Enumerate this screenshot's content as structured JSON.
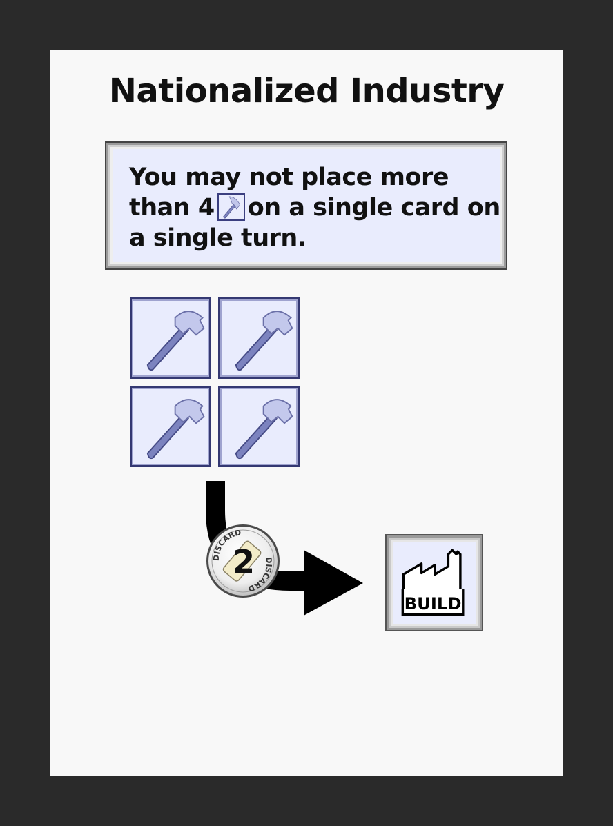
{
  "card": {
    "title": "Nationalized Industry",
    "rule_part1": "You may not place more than 4",
    "rule_part2": "on a single card on a single turn.",
    "hammer_count": 4,
    "discard_word": "DISCARD",
    "discard_number": "2",
    "build_label": "BUILD"
  },
  "icons": {
    "resource": "hammer-icon",
    "action": "factory-build-icon",
    "cost": "discard-token-icon",
    "flow": "arrow-icon"
  },
  "colors": {
    "background": "#2a2a2a",
    "card": "#f8f8f8",
    "box_fill": "#e9ecfd",
    "hammer": "#7c83bf",
    "tile_border": "#343872"
  }
}
